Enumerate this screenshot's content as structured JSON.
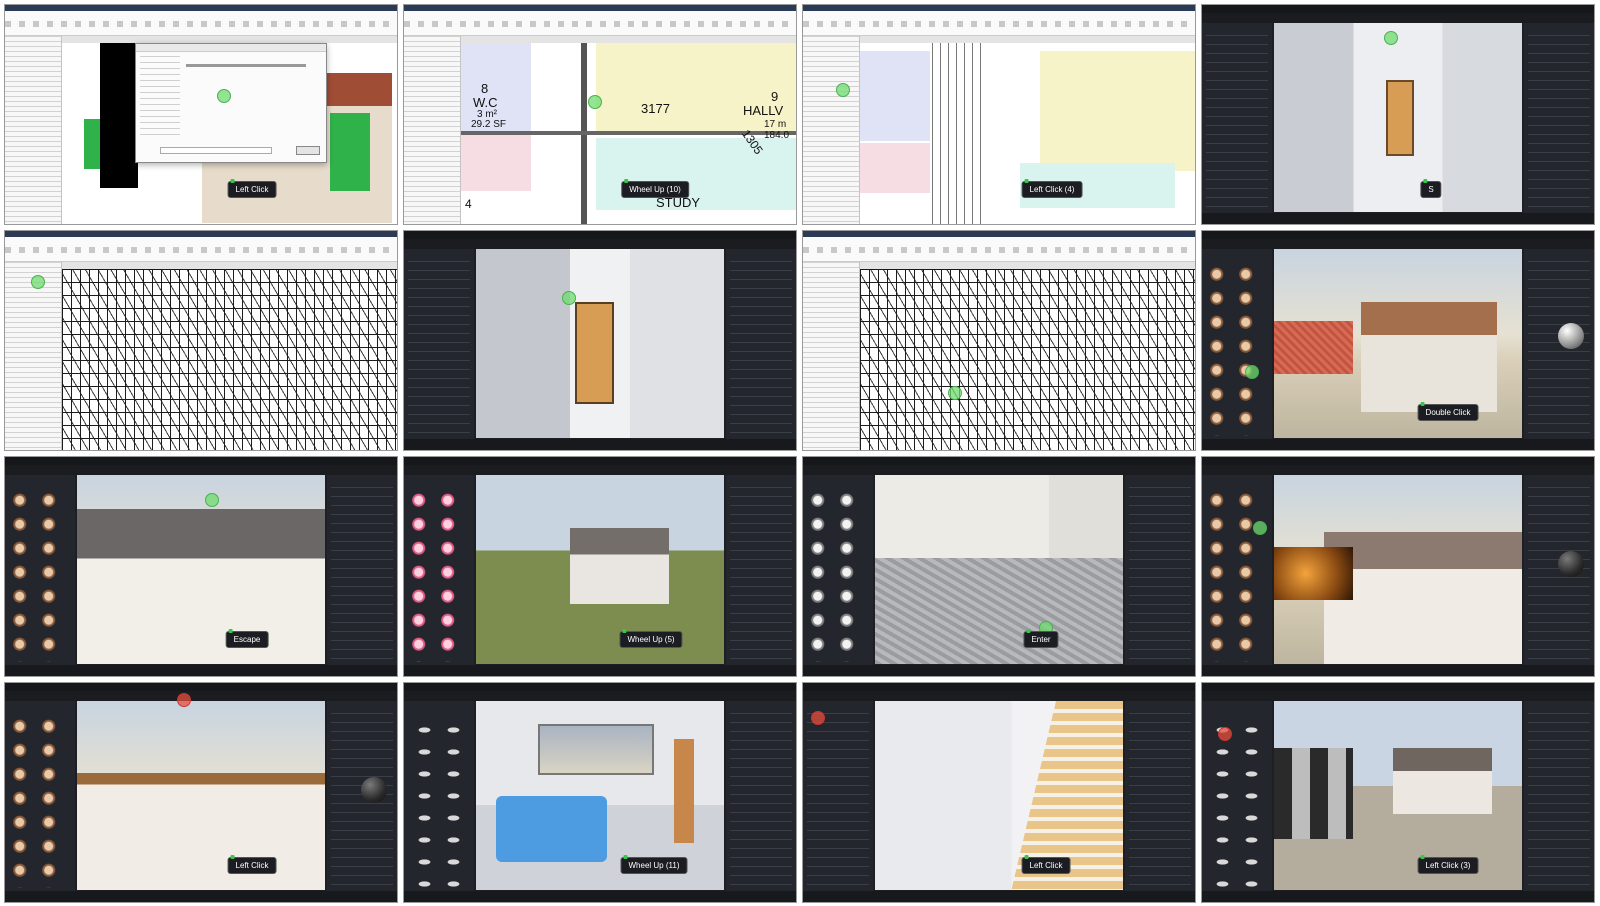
{
  "tiles": [
    {
      "app": "revit",
      "badge": "Left Click"
    },
    {
      "app": "revit",
      "badge": "Wheel Up (10)",
      "floorplan": {
        "room_a_num": "8",
        "room_a_name": "W.C",
        "room_a_area_m": "3 m²",
        "room_a_area_sf": "29.2 SF",
        "dim_a": "3177",
        "room_b_num": "9",
        "room_b_name": "HALLV",
        "room_b_area_m": "17 m",
        "room_b_area_sf": "184.0",
        "dim_b": "1305",
        "label_c": "4",
        "label_d": "STUDY"
      }
    },
    {
      "app": "revit",
      "badge": "Left Click (4)"
    },
    {
      "app": "twinmotion",
      "badge": "S"
    },
    {
      "app": "revit",
      "badge": ""
    },
    {
      "app": "twinmotion",
      "badge": ""
    },
    {
      "app": "revit",
      "badge": ""
    },
    {
      "app": "twinmotion",
      "badge": "Double Click"
    },
    {
      "app": "twinmotion",
      "badge": "Escape"
    },
    {
      "app": "twinmotion",
      "badge": "Wheel Up (5)"
    },
    {
      "app": "twinmotion",
      "badge": "Enter"
    },
    {
      "app": "twinmotion",
      "badge": ""
    },
    {
      "app": "twinmotion",
      "badge": "Left Click"
    },
    {
      "app": "twinmotion",
      "badge": "Wheel Up (11)"
    },
    {
      "app": "twinmotion",
      "badge": "Left Click"
    },
    {
      "app": "twinmotion",
      "badge": "Left Click (3)"
    }
  ]
}
